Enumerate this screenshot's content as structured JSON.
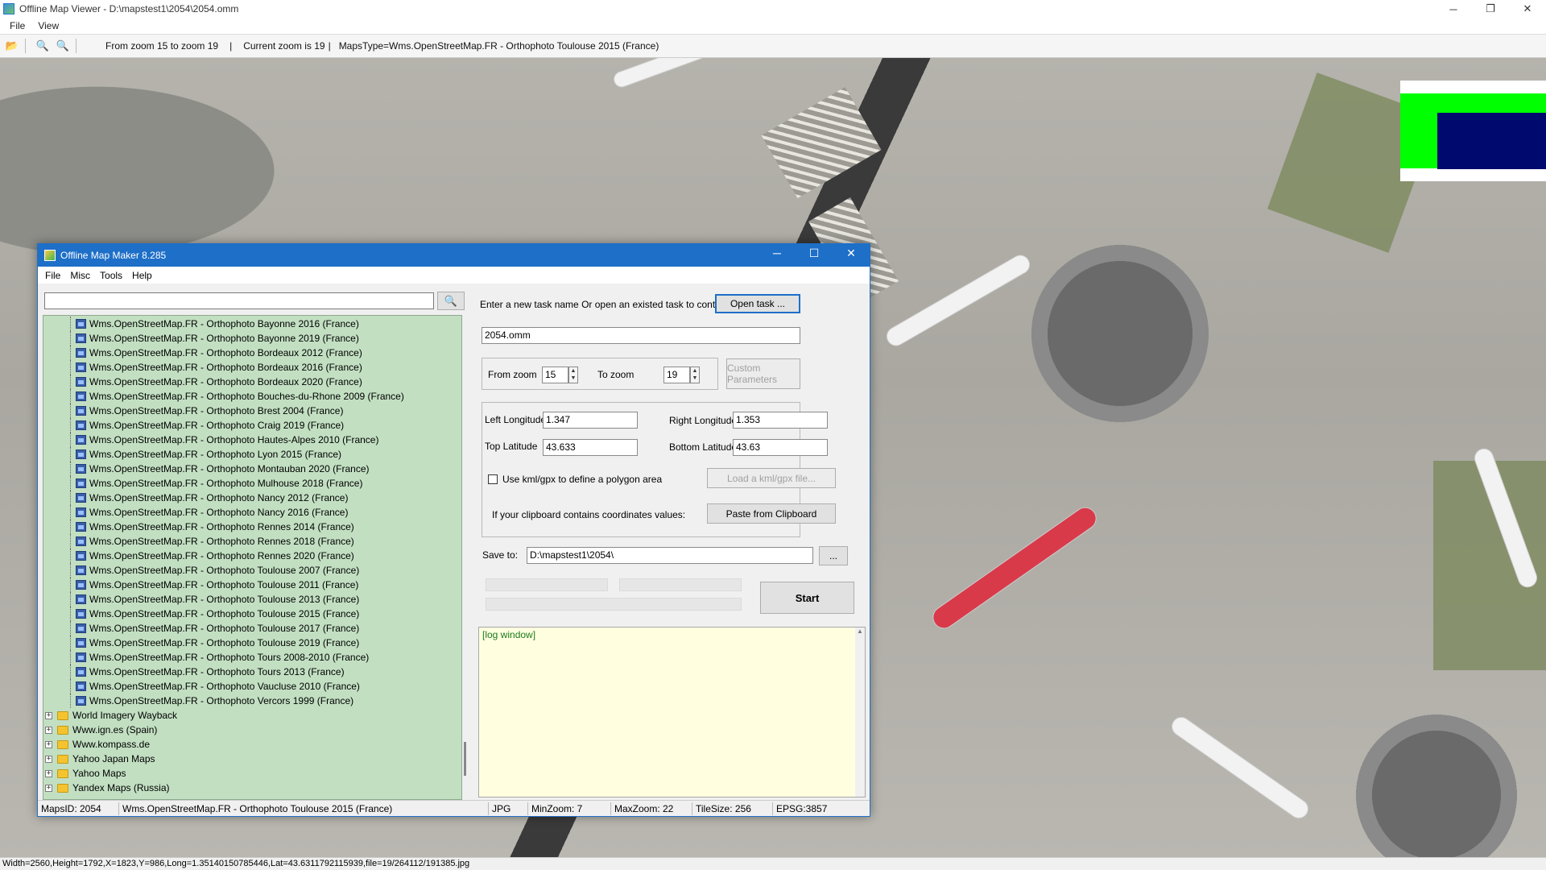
{
  "viewer": {
    "title": "Offline Map Viewer - D:\\mapstest1\\2054\\2054.omm",
    "menu": [
      "File",
      "View"
    ],
    "toolbar": {
      "zoom_range": "From zoom 15 to zoom 19",
      "current_zoom": "Current zoom is 19",
      "maps_type": "MapsType=Wms.OpenStreetMap.FR - Orthophoto Toulouse 2015 (France)"
    },
    "statusbar": "Width=2560,Height=1792,X=1823,Y=986,Long=1.35140150785446,Lat=43.6311792115939,file=19/264112/191385.jpg",
    "indicator_colors": {
      "outer": "#00ff00",
      "inner": "#000a6e"
    }
  },
  "maker": {
    "title": "Offline Map Maker 8.285",
    "menu": [
      "File",
      "Misc",
      "Tools",
      "Help"
    ],
    "search_value": "",
    "tree_leaves": [
      "Wms.OpenStreetMap.FR - Orthophoto Bayonne 2016 (France)",
      "Wms.OpenStreetMap.FR - Orthophoto Bayonne 2019 (France)",
      "Wms.OpenStreetMap.FR - Orthophoto Bordeaux 2012 (France)",
      "Wms.OpenStreetMap.FR - Orthophoto Bordeaux 2016 (France)",
      "Wms.OpenStreetMap.FR - Orthophoto Bordeaux 2020 (France)",
      "Wms.OpenStreetMap.FR - Orthophoto Bouches-du-Rhone 2009 (France)",
      "Wms.OpenStreetMap.FR - Orthophoto Brest 2004 (France)",
      "Wms.OpenStreetMap.FR - Orthophoto Craig 2019 (France)",
      "Wms.OpenStreetMap.FR - Orthophoto Hautes-Alpes 2010 (France)",
      "Wms.OpenStreetMap.FR - Orthophoto Lyon 2015 (France)",
      "Wms.OpenStreetMap.FR - Orthophoto Montauban 2020 (France)",
      "Wms.OpenStreetMap.FR - Orthophoto Mulhouse 2018 (France)",
      "Wms.OpenStreetMap.FR - Orthophoto Nancy 2012 (France)",
      "Wms.OpenStreetMap.FR - Orthophoto Nancy 2016 (France)",
      "Wms.OpenStreetMap.FR - Orthophoto Rennes 2014 (France)",
      "Wms.OpenStreetMap.FR - Orthophoto Rennes 2018 (France)",
      "Wms.OpenStreetMap.FR - Orthophoto Rennes 2020 (France)",
      "Wms.OpenStreetMap.FR - Orthophoto Toulouse 2007 (France)",
      "Wms.OpenStreetMap.FR - Orthophoto Toulouse 2011 (France)",
      "Wms.OpenStreetMap.FR - Orthophoto Toulouse 2013 (France)",
      "Wms.OpenStreetMap.FR - Orthophoto Toulouse 2015 (France)",
      "Wms.OpenStreetMap.FR - Orthophoto Toulouse 2017 (France)",
      "Wms.OpenStreetMap.FR - Orthophoto Toulouse 2019 (France)",
      "Wms.OpenStreetMap.FR - Orthophoto Tours 2008-2010 (France)",
      "Wms.OpenStreetMap.FR - Orthophoto Tours 2013 (France)",
      "Wms.OpenStreetMap.FR - Orthophoto Vaucluse 2010 (France)",
      "Wms.OpenStreetMap.FR - Orthophoto Vercors 1999 (France)"
    ],
    "tree_folders": [
      "World Imagery Wayback",
      "Www.ign.es (Spain)",
      "Www.kompass.de",
      "Yahoo Japan Maps",
      "Yahoo Maps",
      "Yandex Maps (Russia)"
    ],
    "task_prompt": "Enter a new task name Or open an existed task to continue:",
    "open_task_label": "Open task ...",
    "task_name": "2054.omm",
    "from_zoom_label": "From zoom",
    "from_zoom": "15",
    "to_zoom_label": "To zoom",
    "to_zoom": "19",
    "custom_params_label": "Custom Parameters",
    "left_lon_label": "Left Longitude",
    "left_lon": "1.347",
    "right_lon_label": "Right Longitude",
    "right_lon": "1.353",
    "top_lat_label": "Top Latitude",
    "top_lat": "43.633",
    "bottom_lat_label": "Bottom Latitude",
    "bottom_lat": "43.63",
    "kml_checkbox_label": "Use kml/gpx to define a polygon area",
    "kml_checked": false,
    "load_kml_label": "Load a kml/gpx file...",
    "clipboard_prompt": "If your clipboard contains coordinates values:",
    "paste_label": "Paste from Clipboard",
    "save_to_label": "Save to:",
    "save_to": "D:\\mapstest1\\2054\\",
    "browse_label": "...",
    "start_label": "Start",
    "log_text": "[log window]",
    "status": {
      "maps_id": "MapsID: 2054",
      "map_name": "Wms.OpenStreetMap.FR - Orthophoto Toulouse 2015 (France)",
      "format": "JPG",
      "min_zoom": "MinZoom: 7",
      "max_zoom": "MaxZoom: 22",
      "tile_size": "TileSize: 256",
      "epsg": "EPSG:3857"
    }
  }
}
